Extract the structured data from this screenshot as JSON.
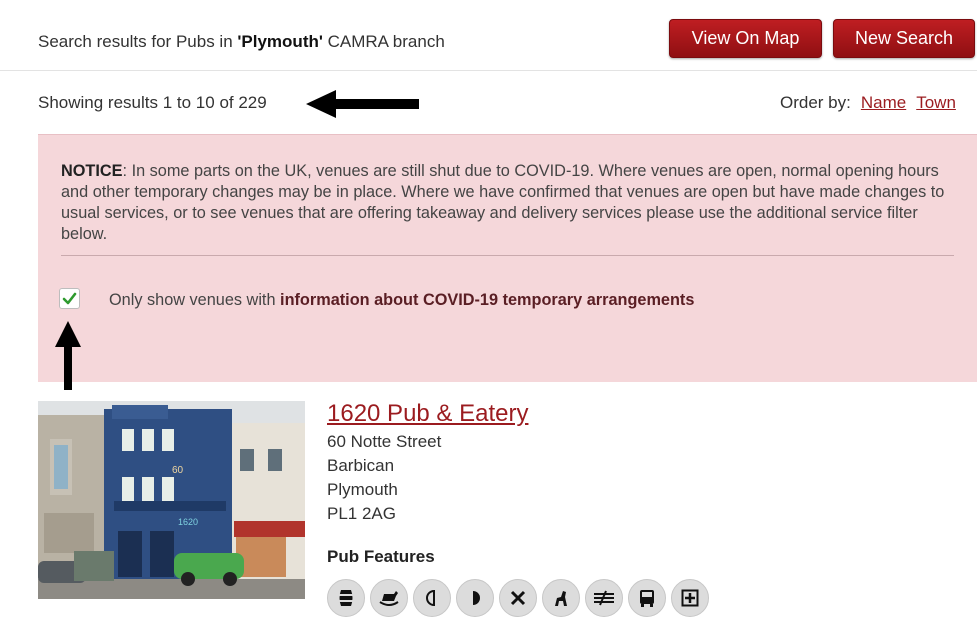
{
  "header": {
    "summary_prefix": "Search results for Pubs in ",
    "summary_place": "'Plymouth'",
    "summary_suffix": " CAMRA branch",
    "view_on_map": "View On Map",
    "new_search": "New Search"
  },
  "results": {
    "count_text": "Showing results 1 to 10 of 229",
    "order_by_label": "Order by:",
    "order_options": [
      "Name",
      "Town"
    ]
  },
  "notice": {
    "label": "NOTICE",
    "text": ": In some parts on the UK, venues are still shut due to COVID-19. Where venues are open, normal opening hours and other temporary changes may be in place. Where we have confirmed that venues are open but have made changes to usual services, or to see venues that are offering takeaway and delivery services please use the additional service filter below.",
    "filter_prefix": "Only show venues with ",
    "filter_bold": "information about COVID-19 temporary arrangements",
    "filter_checked": true
  },
  "venue": {
    "name": "1620 Pub & Eatery",
    "address": [
      "60 Notte Street",
      "Barbican",
      "Plymouth",
      "PL1 2AG"
    ],
    "photo_sign": "1620",
    "photo_number": "60",
    "features_heading": "Pub Features",
    "feature_icons": [
      "barrel-icon",
      "rocking-horse-icon",
      "half-moon-left-icon",
      "half-moon-right-icon",
      "cross-icon",
      "dog-icon",
      "train-icon",
      "bus-icon",
      "plus-box-icon"
    ]
  },
  "colors": {
    "accent": "#9b1b1f",
    "button": "#b0181c",
    "notice_bg": "#f5d7da",
    "checkbox_tick": "#2e9a2e"
  }
}
